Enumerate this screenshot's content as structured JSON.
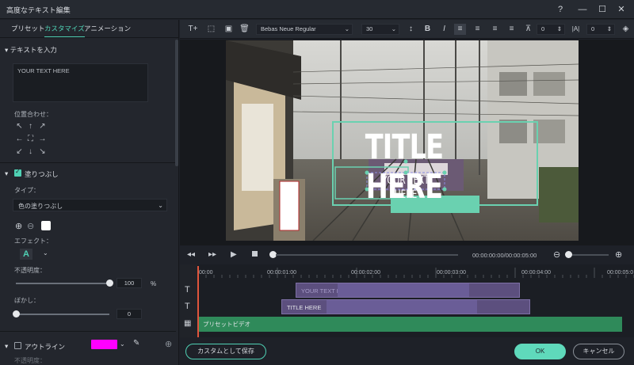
{
  "window": {
    "title": "高度なテキスト編集"
  },
  "tabs": [
    {
      "label": "プリセット"
    },
    {
      "label": "カスタマイズ"
    },
    {
      "label": "アニメーション"
    }
  ],
  "left": {
    "text_section": {
      "title": "テキストを入力",
      "value": "YOUR TEXT HERE"
    },
    "align": {
      "label": "位置合わせ："
    },
    "fill": {
      "title": "塗りつぶし",
      "checked": true,
      "type_label": "タイプ：",
      "type_value": "色の塗りつぶし",
      "color": "#ffffff"
    },
    "effect": {
      "label": "エフェクト："
    },
    "opacity": {
      "label": "不透明度：",
      "value": "100",
      "unit": "%",
      "level": 1.0
    },
    "blur": {
      "label": "ぼかし：",
      "value": "0",
      "level": 0
    },
    "outline": {
      "title": "アウトライン",
      "checked": false,
      "color": "#ff00ff",
      "sub": "不透明度："
    }
  },
  "toolbar": {
    "font": "Bebas Neue Regular",
    "size": "30",
    "spacing": "0",
    "line": "0",
    "bold": "B",
    "italic": "I"
  },
  "preview": {
    "title": "TITLE HERE",
    "subtitle": "YOUR TEXT HERE"
  },
  "transport": {
    "timecode": "00:00:00:00/00:00:05:00"
  },
  "ruler": [
    "00:00",
    "00:00:01:00",
    "00:00:02:00",
    "00:00:03:00",
    "00:00:04:00",
    "00:00:05:0"
  ],
  "tracks": [
    {
      "clip": "YOUR TEXT HERE"
    },
    {
      "clip": "TITLE HERE"
    },
    {
      "clip": "プリセットビデオ"
    }
  ],
  "buttons": {
    "save_custom": "カスタムとして保存",
    "ok": "OK",
    "cancel": "キャンセル"
  }
}
